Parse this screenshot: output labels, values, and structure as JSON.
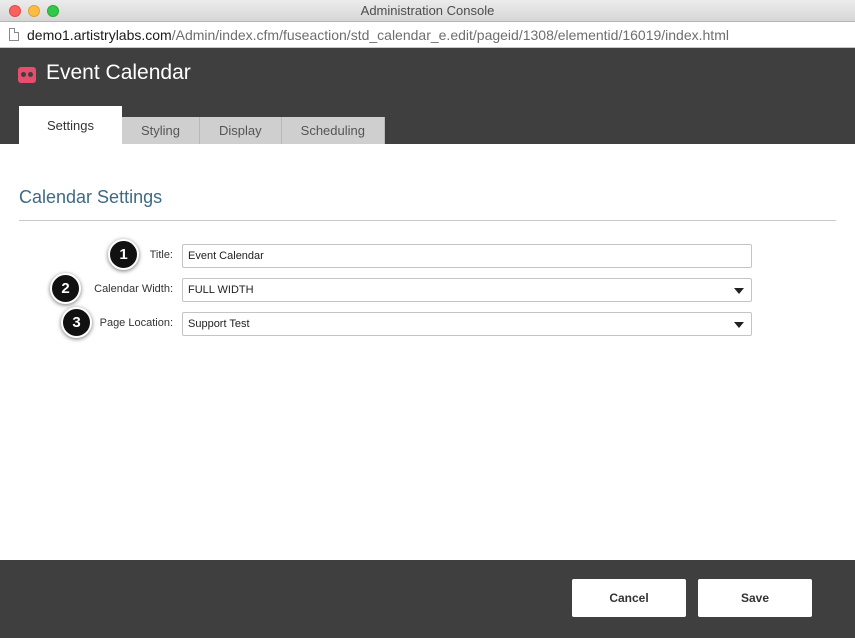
{
  "window": {
    "title": "Administration Console"
  },
  "address_bar": {
    "host": "demo1.artistrylabs.com",
    "path": "/Admin/index.cfm/fuseaction/std_calendar_e.edit/pageid/1308/elementid/16019/index.html"
  },
  "header": {
    "app_title": "Event Calendar",
    "logo_icon": "event-calendar-logo-icon",
    "accent_color": "#e84d6e"
  },
  "tabs": [
    {
      "label": "Settings",
      "active": true
    },
    {
      "label": "Styling",
      "active": false
    },
    {
      "label": "Display",
      "active": false
    },
    {
      "label": "Scheduling",
      "active": false
    }
  ],
  "section": {
    "title": "Calendar Settings",
    "title_color": "#3d6a84"
  },
  "form": {
    "title": {
      "label": "Title:",
      "value": "Event Calendar",
      "callout": "1"
    },
    "calendar_width": {
      "label": "Calendar Width:",
      "value": "FULL WIDTH",
      "callout": "2"
    },
    "page_location": {
      "label": "Page Location:",
      "value": "Support Test",
      "callout": "3"
    }
  },
  "footer": {
    "cancel_label": "Cancel",
    "save_label": "Save"
  }
}
